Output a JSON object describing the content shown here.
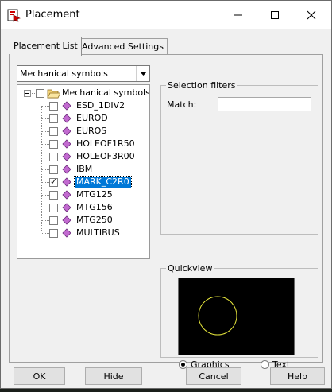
{
  "window": {
    "title": "Placement",
    "icon": "placement-app-icon"
  },
  "titlebar_buttons": {
    "minimize": "minimize-icon",
    "maximize": "maximize-icon",
    "close": "close-icon"
  },
  "tabs": [
    {
      "label": "Placement List",
      "active": true
    },
    {
      "label": "Advanced Settings",
      "active": false
    }
  ],
  "combo": {
    "value": "Mechanical symbols"
  },
  "tree": {
    "root": {
      "label": "Mechanical symbols",
      "expanded": true,
      "checked": false
    },
    "items": [
      {
        "label": "ESD_1DIV2",
        "checked": false,
        "selected": false
      },
      {
        "label": "EUROD",
        "checked": false,
        "selected": false
      },
      {
        "label": "EUROS",
        "checked": false,
        "selected": false
      },
      {
        "label": "HOLEOF1R50",
        "checked": false,
        "selected": false
      },
      {
        "label": "HOLEOF3R00",
        "checked": false,
        "selected": false
      },
      {
        "label": "IBM",
        "checked": false,
        "selected": false
      },
      {
        "label": "MARK_C2R0",
        "checked": true,
        "selected": true
      },
      {
        "label": "MTG125",
        "checked": false,
        "selected": false
      },
      {
        "label": "MTG156",
        "checked": false,
        "selected": false
      },
      {
        "label": "MTG250",
        "checked": false,
        "selected": false
      },
      {
        "label": "MULTIBUS",
        "checked": false,
        "selected": false
      }
    ]
  },
  "selection_filters": {
    "legend": "Selection filters",
    "match_label": "Match:",
    "match_value": ""
  },
  "quickview": {
    "legend": "Quickview",
    "preview_shape_color": "#e6e63c",
    "radio_graphics": "Graphics",
    "radio_text": "Text",
    "selected_mode": "graphics"
  },
  "buttons": {
    "ok": "OK",
    "hide": "Hide",
    "cancel": "Cancel",
    "help": "Help"
  },
  "colors": {
    "selection": "#0078d7",
    "symbol_icon": "#c26ad0"
  }
}
